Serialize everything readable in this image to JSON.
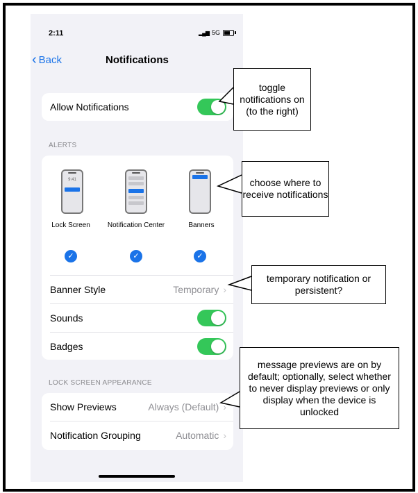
{
  "status_bar": {
    "time": "2:11",
    "network": "5G"
  },
  "nav": {
    "back_label": "Back",
    "title": "Notifications"
  },
  "allow_notifications": {
    "label": "Allow Notifications",
    "enabled": true
  },
  "alerts": {
    "section_label": "ALERTS",
    "options": [
      {
        "label": "Lock Screen",
        "checked": true,
        "clock": "9:41"
      },
      {
        "label": "Notification Center",
        "checked": true
      },
      {
        "label": "Banners",
        "checked": true
      }
    ],
    "banner_style": {
      "label": "Banner Style",
      "value": "Temporary"
    },
    "sounds": {
      "label": "Sounds",
      "enabled": true
    },
    "badges": {
      "label": "Badges",
      "enabled": true
    }
  },
  "lock_screen_appearance": {
    "section_label": "LOCK SCREEN APPEARANCE",
    "show_previews": {
      "label": "Show Previews",
      "value": "Always (Default)"
    },
    "notification_grouping": {
      "label": "Notification Grouping",
      "value": "Automatic"
    }
  },
  "callouts": {
    "toggle": "toggle notifications on (to the right)",
    "choose": "choose where to receive notifications",
    "temporary": "temporary notification or persistent?",
    "previews": "message previews are on by default; optionally, select whether to never display previews or only display when the device is unlocked"
  },
  "colors": {
    "accent": "#1a73e8",
    "toggle_on": "#34c759",
    "background": "#f2f2f7"
  }
}
